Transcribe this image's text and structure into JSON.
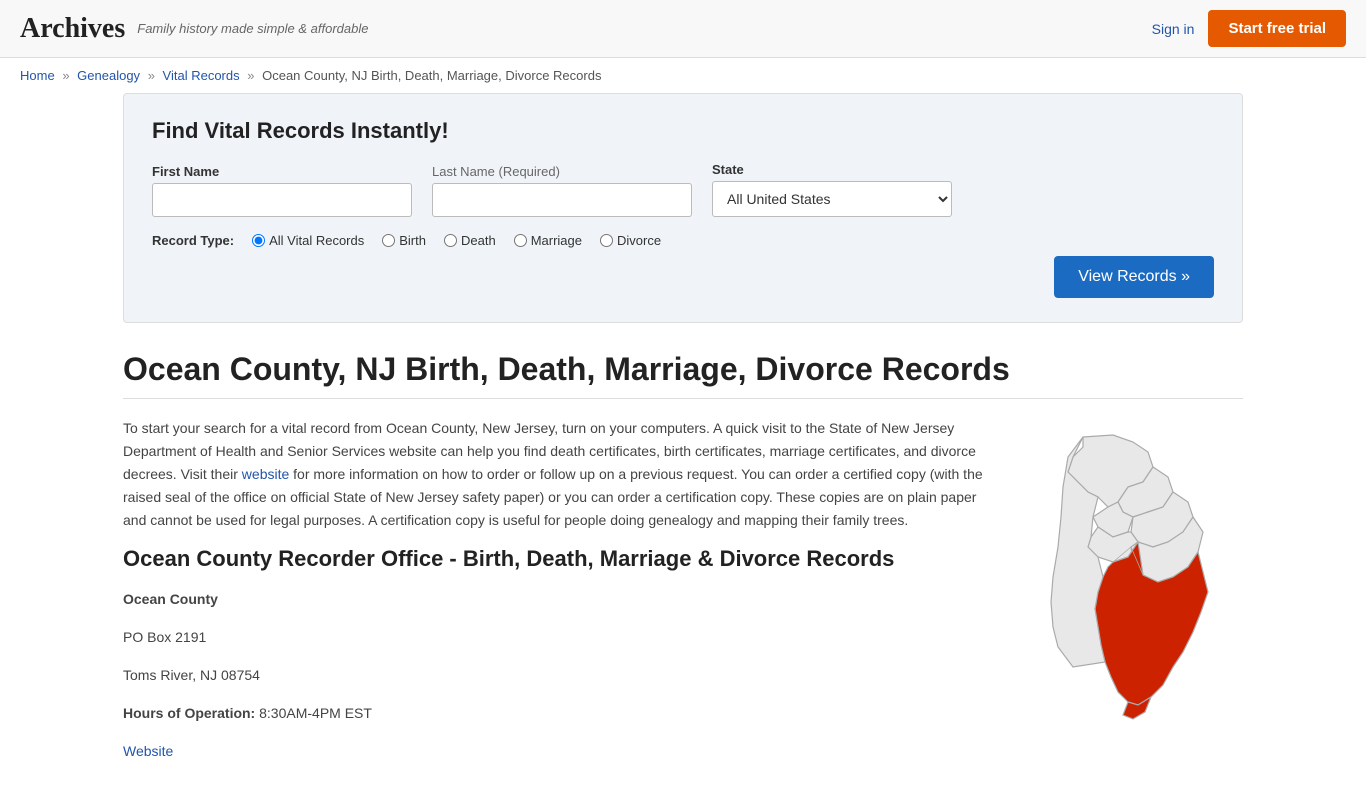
{
  "site": {
    "logo": "Archives",
    "tagline": "Family history made simple & affordable",
    "sign_in": "Sign in",
    "trial_btn": "Start free trial"
  },
  "breadcrumb": {
    "home": "Home",
    "genealogy": "Genealogy",
    "vital_records": "Vital Records",
    "current": "Ocean County, NJ Birth, Death, Marriage, Divorce Records"
  },
  "search": {
    "title": "Find Vital Records Instantly!",
    "first_name_label": "First Name",
    "last_name_label": "Last Name",
    "last_name_required": "(Required)",
    "state_label": "State",
    "state_default": "All United States",
    "record_type_label": "Record Type:",
    "record_types": [
      "All Vital Records",
      "Birth",
      "Death",
      "Marriage",
      "Divorce"
    ],
    "view_records_btn": "View Records »"
  },
  "page": {
    "title": "Ocean County, NJ Birth, Death, Marriage, Divorce Records",
    "intro": "To start your search for a vital record from Ocean County, New Jersey, turn on your computers. A quick visit to the State of New Jersey Department of Health and Senior Services website can help you find death certificates, birth certificates, marriage certificates, and divorce decrees. Visit their website for more information on how to order or follow up on a previous request. You can order a certified copy (with the raised seal of the office on official State of New Jersey safety paper) or you can order a certification copy. These copies are on plain paper and cannot be used for legal purposes. A certification copy is useful for people doing genealogy and mapping their family trees.",
    "website_link": "website",
    "recorder_title": "Ocean County Recorder Office - Birth, Death, Marriage & Divorce Records",
    "county_name": "Ocean County",
    "address_line1": "PO Box 2191",
    "address_line2": "Toms River, NJ 08754",
    "hours_label": "Hours of Operation:",
    "hours_value": "8:30AM-4PM EST",
    "website_label": "Website"
  }
}
